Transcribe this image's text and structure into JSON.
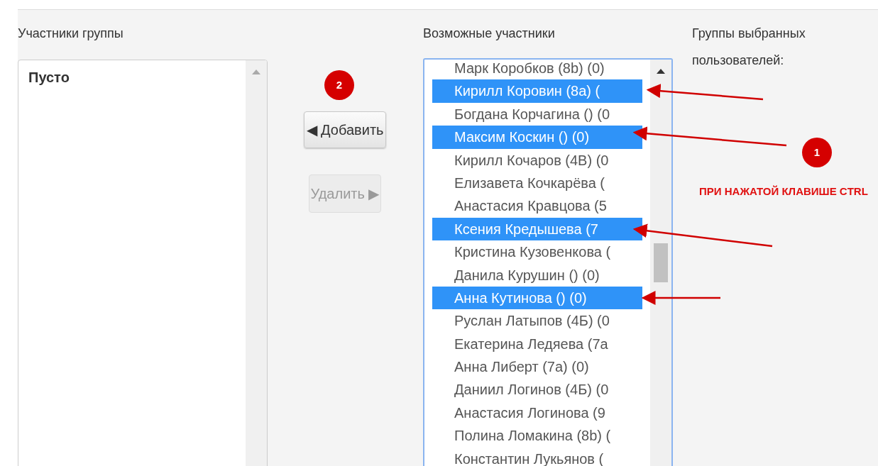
{
  "members": {
    "title": "Участники группы",
    "empty_text": "Пусто"
  },
  "buttons": [
    {
      "label": "◀ Добавить",
      "disabled": false
    },
    {
      "label": "Удалить ▶",
      "disabled": true
    }
  ],
  "candidates": {
    "title": "Возможные участники",
    "items": [
      {
        "label": "Марк Коробков (8b) (0)",
        "selected": false
      },
      {
        "label": "Кирилл Коровин (8а) (",
        "selected": true
      },
      {
        "label": "Богдана Корчагина () (0",
        "selected": false
      },
      {
        "label": "Максим Коскин () (0)",
        "selected": true
      },
      {
        "label": "Кирилл Кочаров (4В) (0",
        "selected": false
      },
      {
        "label": "Елизавета Кочкарёва (",
        "selected": false
      },
      {
        "label": "Анастасия Кравцова (5",
        "selected": false
      },
      {
        "label": "Ксения Кредышева (7",
        "selected": true
      },
      {
        "label": "Кристина Кузовенкова (",
        "selected": false
      },
      {
        "label": "Данила Курушин () (0)",
        "selected": false
      },
      {
        "label": "Анна Кутинова () (0)",
        "selected": true
      },
      {
        "label": "Руслан Латыпов (4Б) (0",
        "selected": false
      },
      {
        "label": "Екатерина Ледяева (7а",
        "selected": false
      },
      {
        "label": "Анна Либерт (7а) (0)",
        "selected": false
      },
      {
        "label": "Даниил Логинов (4Б) (0",
        "selected": false
      },
      {
        "label": "Анастасия Логинова (9",
        "selected": false
      },
      {
        "label": "Полина Ломакина (8b) (",
        "selected": false
      },
      {
        "label": "Константин Лукьянов (",
        "selected": false
      }
    ]
  },
  "selected_groups": {
    "title": "Группы выбранных пользователей:"
  },
  "annotations": [
    {
      "kind": "badge",
      "text": "2"
    },
    {
      "kind": "badge",
      "text": "1"
    },
    {
      "kind": "note",
      "text": "ПРИ НАЖАТОЙ КЛАВИШЕ CTRL"
    }
  ]
}
